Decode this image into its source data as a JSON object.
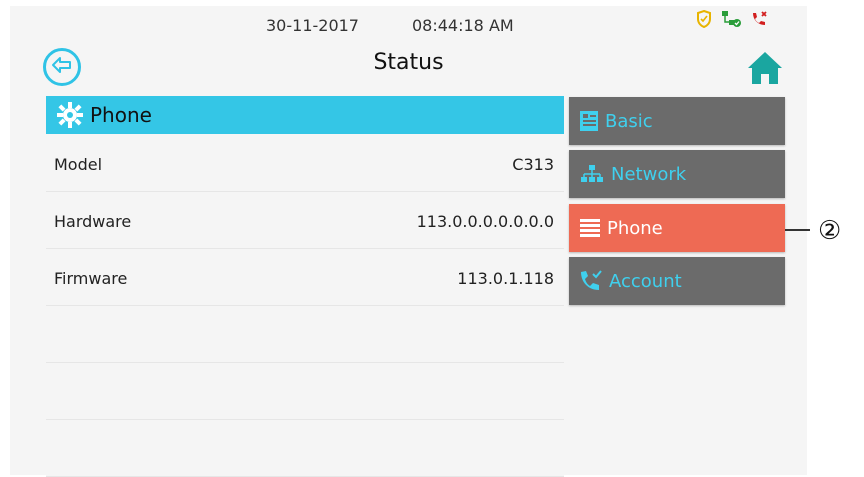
{
  "topbar": {
    "date": "30-11-2017",
    "time": "08:44:18 AM",
    "status_icons": [
      "shield-icon",
      "network-status-icon",
      "missed-call-icon"
    ]
  },
  "header": {
    "title": "Status",
    "back_icon": "back-arrow-icon",
    "home_icon": "home-icon"
  },
  "section": {
    "icon": "gear-icon",
    "title": "Phone"
  },
  "rows": [
    {
      "label": "Model",
      "value": "C313"
    },
    {
      "label": "Hardware",
      "value": "113.0.0.0.0.0.0.0"
    },
    {
      "label": "Firmware",
      "value": "113.0.1.118"
    }
  ],
  "menu": {
    "items": [
      {
        "label": "Basic",
        "icon": "basic-info-icon",
        "active": false
      },
      {
        "label": "Network",
        "icon": "network-icon",
        "active": false
      },
      {
        "label": "Phone",
        "icon": "phone-list-icon",
        "active": true
      },
      {
        "label": "Account",
        "icon": "account-phone-icon",
        "active": false
      }
    ]
  },
  "callout": {
    "label": "②"
  },
  "colors": {
    "accent": "#34c6e6",
    "active_item": "#ee6a54",
    "menu_item": "#6b6b6b",
    "home_icon": "#1aa6a0"
  }
}
